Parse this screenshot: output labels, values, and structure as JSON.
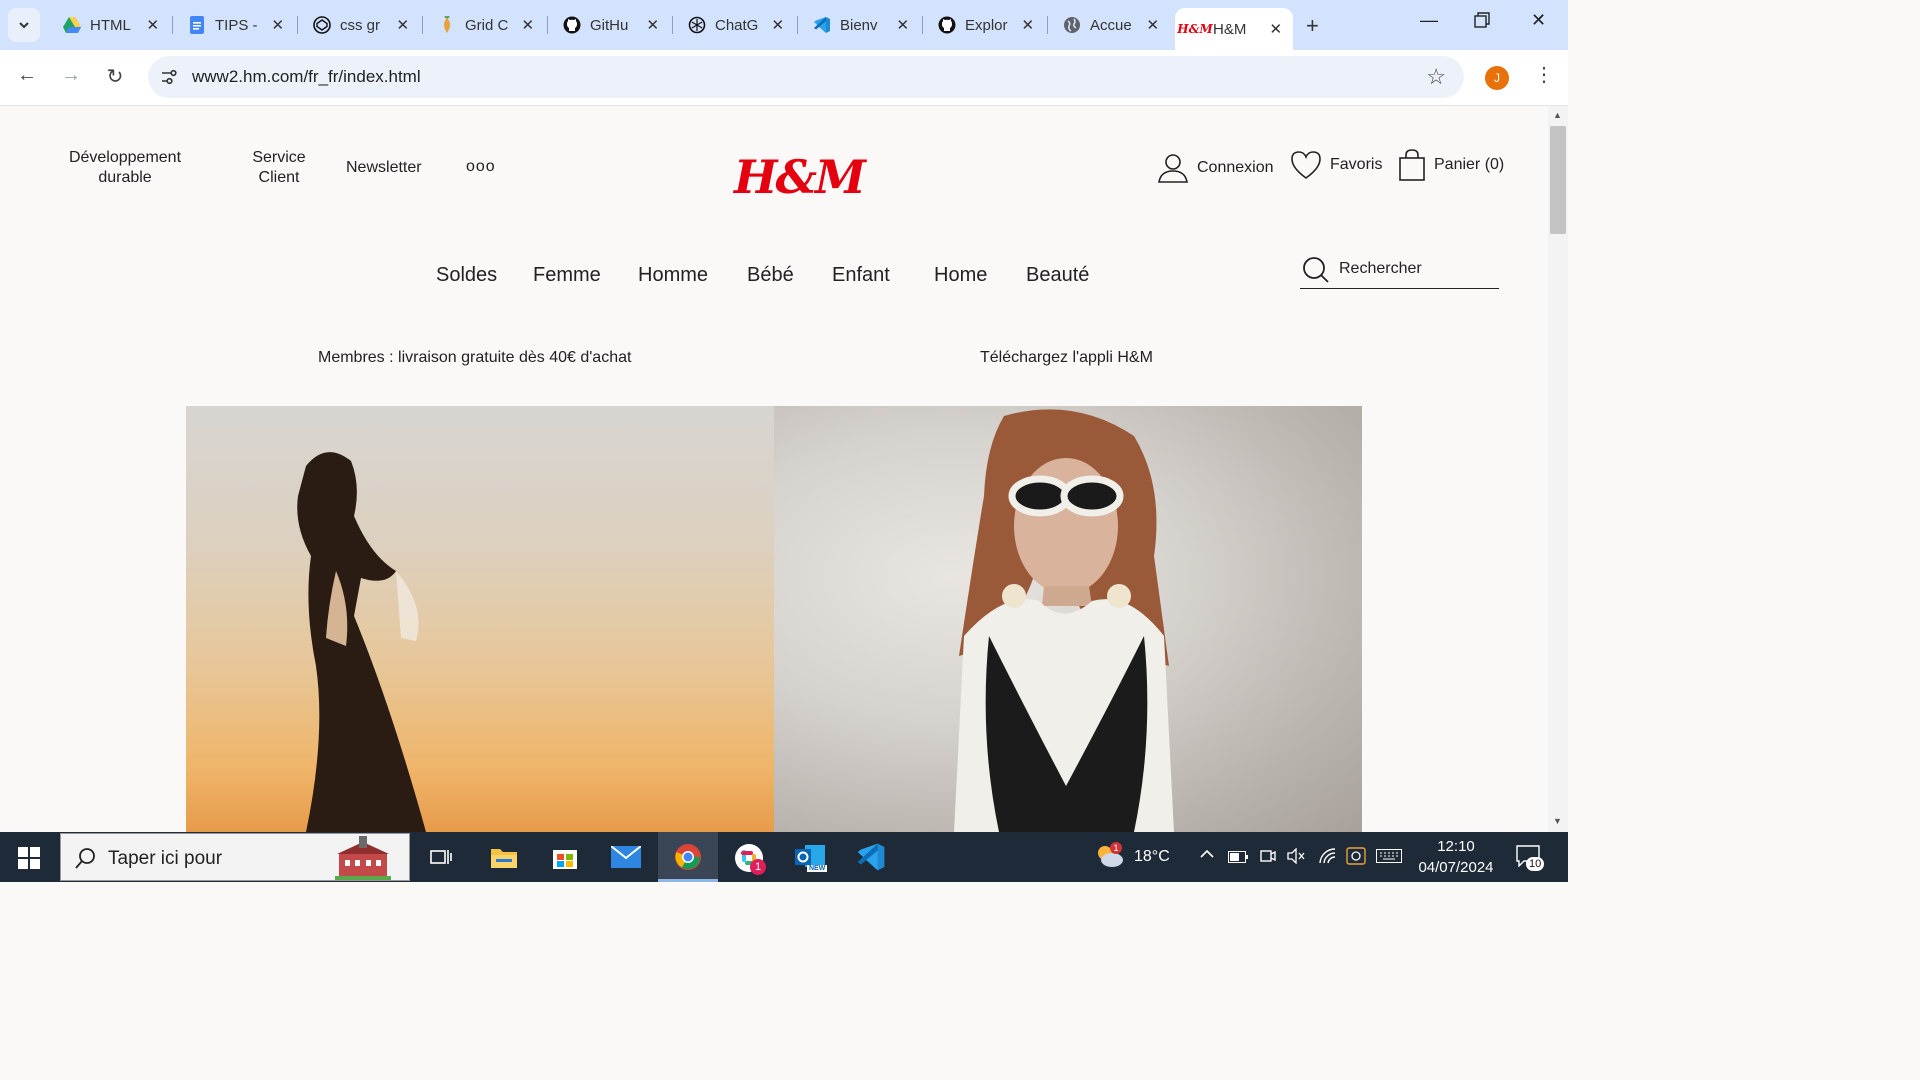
{
  "browser": {
    "tabs": [
      {
        "title": "HTML",
        "icon": "google-drive-icon"
      },
      {
        "title": "TIPS -",
        "icon": "google-docs-icon"
      },
      {
        "title": "css gr",
        "icon": "codepen-icon"
      },
      {
        "title": "Grid C",
        "icon": "grid-garden-icon"
      },
      {
        "title": "GitHu",
        "icon": "github-icon"
      },
      {
        "title": "ChatG",
        "icon": "chatgpt-icon"
      },
      {
        "title": "Bienv",
        "icon": "vscode-icon"
      },
      {
        "title": "Explor",
        "icon": "github-icon"
      },
      {
        "title": "Accue",
        "icon": "globe-icon"
      },
      {
        "title": "H&M",
        "icon": "hm-icon",
        "active": true
      }
    ],
    "url": "www2.hm.com/fr_fr/index.html",
    "profile_initial": "J"
  },
  "header": {
    "utility_links": {
      "sustainability": "Développement durable",
      "customer_service": "Service Client",
      "newsletter": "Newsletter",
      "more": "ooo"
    },
    "logo": "H&M",
    "account": {
      "login": "Connexion",
      "favorites": "Favoris",
      "cart": "Panier (0)"
    },
    "nav": [
      "Soldes",
      "Femme",
      "Homme",
      "Bébé",
      "Enfant",
      "Home",
      "Beauté"
    ],
    "search_placeholder": "Rechercher"
  },
  "promos": {
    "left": "Membres : livraison gratuite dès 40€ d'achat",
    "right": "Téléchargez l'appli H&M"
  },
  "taskbar": {
    "search_placeholder": "Taper ici pour",
    "weather": "18°C",
    "weather_badge": "1",
    "slack_badge": "1",
    "time": "12:10",
    "date": "04/07/2024",
    "notifications": "10",
    "outlook_new": "NEW"
  },
  "colors": {
    "brand": "#e50010",
    "tabbar": "#d3e3fd",
    "taskbar": "#1f2a38"
  }
}
